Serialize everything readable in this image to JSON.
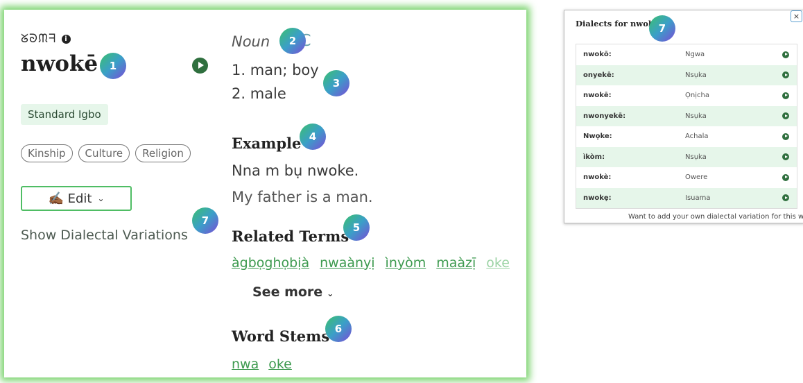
{
  "entry": {
    "nsibidi": "ᘜᘐᙏᖷ",
    "info_icon": "i",
    "word": "nwokē",
    "dialect_label": "Standard Igbo",
    "tags": [
      "Kinship",
      "Culture",
      "Religion"
    ],
    "edit_label": "✍🏾 Edit",
    "show_dialects_label": "Show Dialectal Variations",
    "part_of_speech": "Noun",
    "nsibidi_glyph": "ɪC",
    "definitions": [
      "1. man; boy",
      "2. male"
    ],
    "example_heading": "Example",
    "example_igbo": "Nna m bụ nwoke.",
    "example_english": "My father is a man.",
    "related_heading": "Related Terms",
    "related_terms": [
      "àgbọghọbịà",
      "nwaànyị",
      "ìnyòm",
      "maàzị̄",
      "oke"
    ],
    "see_more_label": "See more",
    "stems_heading": "Word Stems",
    "word_stems": [
      "nwa",
      "oke"
    ]
  },
  "badges": [
    "1",
    "2",
    "3",
    "4",
    "5",
    "6",
    "7",
    "7"
  ],
  "dialect_popup": {
    "title": "Dialects for nwokē",
    "close_label": "×",
    "rows": [
      {
        "word": "nwokō:",
        "dialect": "Ngwa"
      },
      {
        "word": "onyekē:",
        "dialect": "Nsụka"
      },
      {
        "word": "nwokē:",
        "dialect": "Ọnịcha"
      },
      {
        "word": "nwonyekē:",
        "dialect": "Nsụka"
      },
      {
        "word": "Nwọke:",
        "dialect": "Achala"
      },
      {
        "word": "ìkòm:",
        "dialect": "Nsụka"
      },
      {
        "word": "nwokè:",
        "dialect": "Owere"
      },
      {
        "word": "nwokẹ:",
        "dialect": "Isuama"
      }
    ],
    "footer": "Want to add your own dialectal variation for this word?"
  },
  "colors": {
    "accent_green": "#3d9a4f",
    "glow_green": "#7ad36d",
    "row_tint": "#e6f6ea"
  }
}
